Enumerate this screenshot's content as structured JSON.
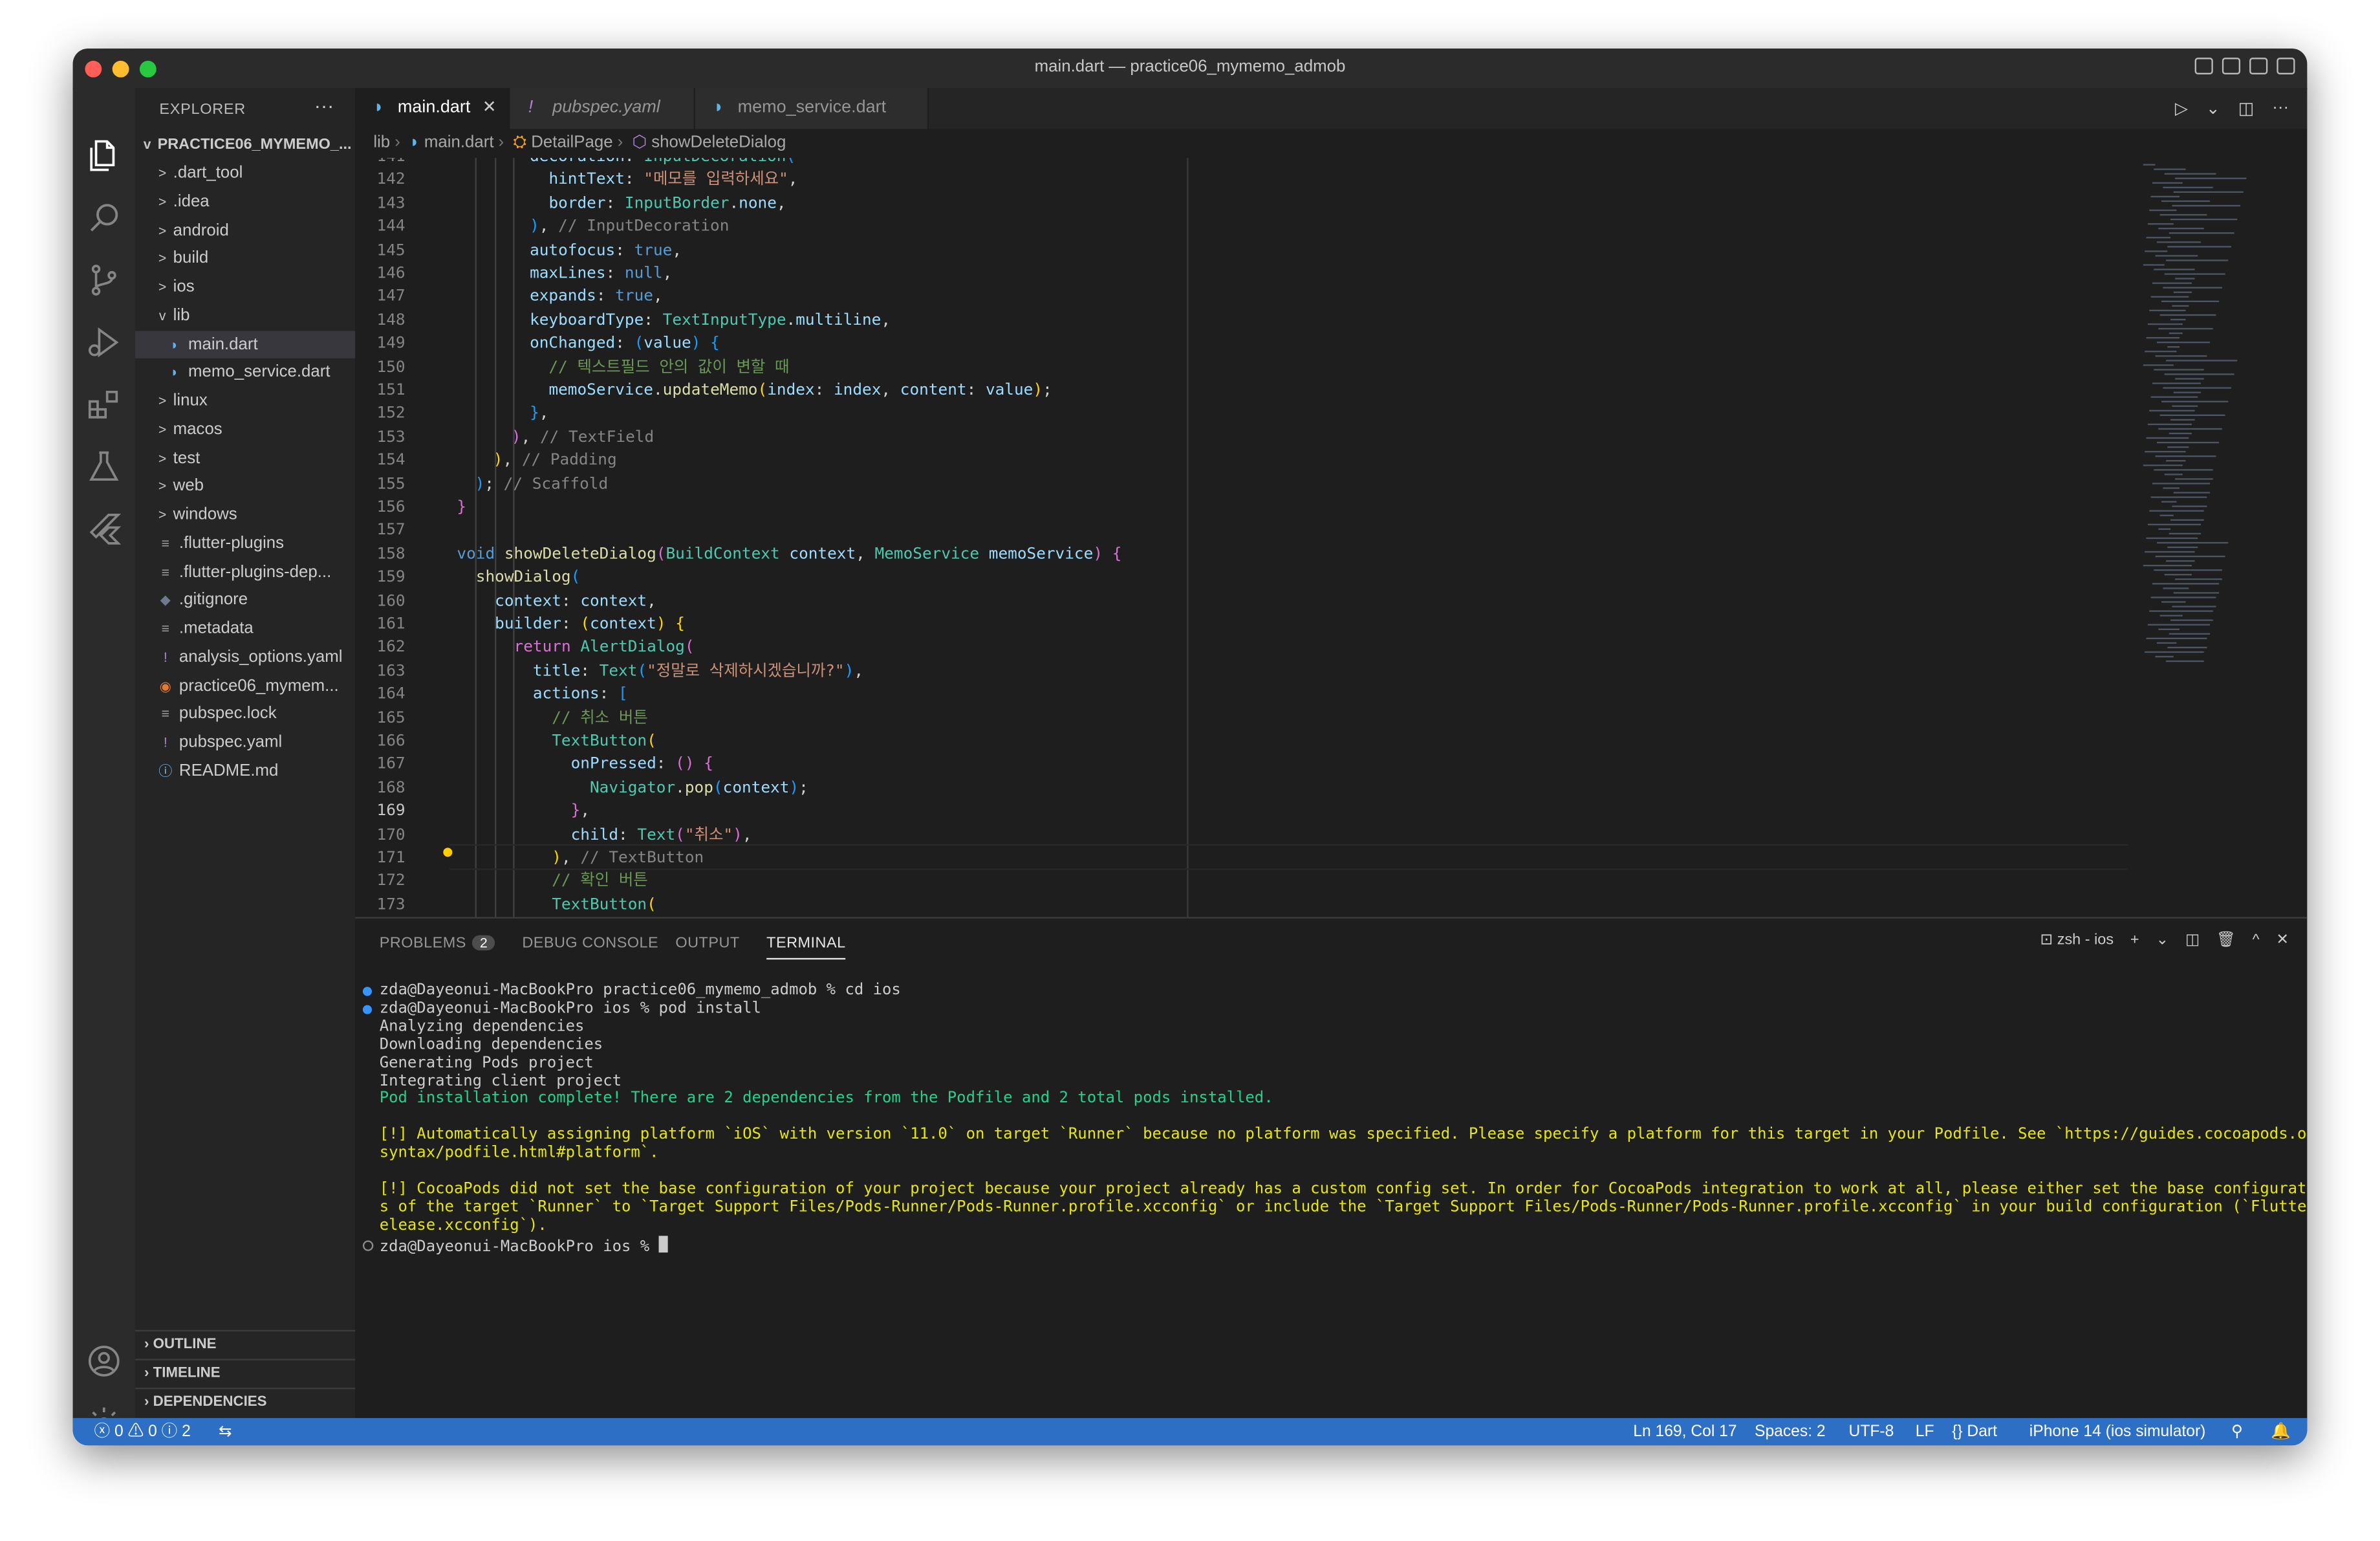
{
  "window": {
    "title": "main.dart — practice06_mymemo_admob",
    "lights": [
      "#ff5f57",
      "#febc2e",
      "#28c840"
    ]
  },
  "activity_bar": [
    "files-icon",
    "search-icon",
    "source-control-icon",
    "run-debug-icon",
    "extensions-icon",
    "testing-icon",
    "flutter-icon",
    "account-icon",
    "settings-gear-icon"
  ],
  "explorer": {
    "title": "EXPLORER",
    "more": "···",
    "root": "PRACTICE06_MYMEMO_...",
    "items": [
      {
        "label": ".dart_tool",
        "kind": "folder",
        "icon": ">"
      },
      {
        "label": ".idea",
        "kind": "folder",
        "icon": ">"
      },
      {
        "label": "android",
        "kind": "folder",
        "icon": ">"
      },
      {
        "label": "build",
        "kind": "folder",
        "icon": ">"
      },
      {
        "label": "ios",
        "kind": "folder",
        "icon": ">"
      },
      {
        "label": "lib",
        "kind": "folder-open",
        "icon": "v"
      },
      {
        "label": "main.dart",
        "kind": "dart",
        "icon": "◗"
      },
      {
        "label": "memo_service.dart",
        "kind": "dart",
        "icon": "◗"
      },
      {
        "label": "linux",
        "kind": "folder",
        "icon": ">"
      },
      {
        "label": "macos",
        "kind": "folder",
        "icon": ">"
      },
      {
        "label": "test",
        "kind": "folder",
        "icon": ">"
      },
      {
        "label": "web",
        "kind": "folder",
        "icon": ">"
      },
      {
        "label": "windows",
        "kind": "folder",
        "icon": ">"
      },
      {
        "label": ".flutter-plugins",
        "kind": "file",
        "icon": "≡"
      },
      {
        "label": ".flutter-plugins-dep...",
        "kind": "file",
        "icon": "≡"
      },
      {
        "label": ".gitignore",
        "kind": "git",
        "icon": "◆"
      },
      {
        "label": ".metadata",
        "kind": "file",
        "icon": "≡"
      },
      {
        "label": "analysis_options.yaml",
        "kind": "yaml",
        "icon": "!"
      },
      {
        "label": "practice06_mymem...",
        "kind": "rss",
        "icon": "◉"
      },
      {
        "label": "pubspec.lock",
        "kind": "file",
        "icon": "≡"
      },
      {
        "label": "pubspec.yaml",
        "kind": "yaml",
        "icon": "!"
      },
      {
        "label": "README.md",
        "kind": "info",
        "icon": "ⓘ"
      }
    ],
    "sections": [
      "OUTLINE",
      "TIMELINE",
      "DEPENDENCIES"
    ]
  },
  "tabs": [
    {
      "label": "main.dart",
      "icon": "◗",
      "active": true,
      "close": "✕"
    },
    {
      "label": "pubspec.yaml",
      "icon": "!",
      "active": false
    },
    {
      "label": "memo_service.dart",
      "icon": "◗",
      "active": false
    }
  ],
  "editor_actions": [
    "▷",
    "⌄",
    "◫",
    "···"
  ],
  "breadcrumb": [
    "lib",
    "main.dart",
    "DetailPage",
    "showDeleteDialog"
  ],
  "code_lines": [
    {
      "n": "141",
      "html": "<span class=\"prop\">decoration</span>: <span class=\"ty\">InputDecoration</span><span class=\"br3\">(</span>"
    },
    {
      "n": "142",
      "html": "  <span class=\"prop\">hintText</span>: <span class=\"str\">\"메모를 입력하세요\"</span>,"
    },
    {
      "n": "143",
      "html": "  <span class=\"prop\">border</span>: <span class=\"ty\">InputBorder</span>.<span class=\"prop\">none</span>,"
    },
    {
      "n": "144",
      "html": "<span class=\"br3\">)</span>, <span class=\"cmt2\">// InputDecoration</span>"
    },
    {
      "n": "145",
      "html": "<span class=\"prop\">autofocus</span>: <span class=\"kw\">true</span>,"
    },
    {
      "n": "146",
      "html": "<span class=\"prop\">maxLines</span>: <span class=\"kw\">null</span>,"
    },
    {
      "n": "147",
      "html": "<span class=\"prop\">expands</span>: <span class=\"kw\">true</span>,"
    },
    {
      "n": "148",
      "html": "<span class=\"prop\">keyboardType</span>: <span class=\"ty\">TextInputType</span>.<span class=\"prop\">multiline</span>,"
    },
    {
      "n": "149",
      "html": "<span class=\"prop\">onChanged</span>: <span class=\"br3\">(</span><span class=\"prop\">value</span><span class=\"br3\">)</span> <span class=\"br3\">{</span>"
    },
    {
      "n": "150",
      "html": "  <span class=\"cm\">// 텍스트필드 안의 값이 변할 때</span>"
    },
    {
      "n": "151",
      "html": "  <span class=\"prop\">memoService</span>.<span class=\"fn\">updateMemo</span><span class=\"br1\">(</span><span class=\"prop\">index</span>: <span class=\"prop\">index</span>, <span class=\"prop\">content</span>: <span class=\"prop\">value</span><span class=\"br1\">)</span>;"
    },
    {
      "n": "152",
      "html": "<span class=\"br3\">}</span>,"
    },
    {
      "n": "153",
      "html": "<span class=\"br2\">)</span>, <span class=\"cmt2\">// TextField</span>"
    },
    {
      "n": "154",
      "html": "<span class=\"br1\">)</span>, <span class=\"cmt2\">// Padding</span>"
    },
    {
      "n": "155",
      "html": "<span class=\"br3\">)</span>; <span class=\"cmt2\">// Scaffold</span>"
    },
    {
      "n": "156",
      "html": "<span class=\"br2\">}</span>"
    },
    {
      "n": "157",
      "html": ""
    },
    {
      "n": "158",
      "html": "<span class=\"kw\">void</span> <span class=\"fn\">showDeleteDialog</span><span class=\"br2\">(</span><span class=\"ty\">BuildContext</span> <span class=\"prop\">context</span>, <span class=\"ty\">MemoService</span> <span class=\"prop\">memoService</span><span class=\"br2\">)</span> <span class=\"br2\">{</span>"
    },
    {
      "n": "159",
      "html": "  <span class=\"fn\">showDialog</span><span class=\"br3\">(</span>"
    },
    {
      "n": "160",
      "html": "    <span class=\"prop\">context</span>: <span class=\"prop\">context</span>,"
    },
    {
      "n": "161",
      "html": "    <span class=\"prop\">builder</span>: <span class=\"br1\">(</span><span class=\"prop\">context</span><span class=\"br1\">)</span> <span class=\"br1\">{</span>"
    },
    {
      "n": "162",
      "html": "      <span class=\"br2\">return</span> <span class=\"ty\">AlertDialog</span><span class=\"br2\">(</span>"
    },
    {
      "n": "163",
      "html": "        <span class=\"prop\">title</span>: <span class=\"ty\">Text</span><span class=\"br3\">(</span><span class=\"str\">\"정말로 삭제하시겠습니까?\"</span><span class=\"br3\">)</span>,"
    },
    {
      "n": "164",
      "html": "        <span class=\"prop\">actions</span>: <span class=\"br3\">[</span>"
    },
    {
      "n": "165",
      "html": "          <span class=\"cm\">// 취소 버튼</span>"
    },
    {
      "n": "166",
      "html": "          <span class=\"ty\">TextButton</span><span class=\"br1\">(</span>"
    },
    {
      "n": "167",
      "html": "            <span class=\"prop\">onPressed</span>: <span class=\"br2\">()</span> <span class=\"br2\">{</span>"
    },
    {
      "n": "168",
      "html": "              <span class=\"ty\">Navigator</span>.<span class=\"fn\">pop</span><span class=\"br3\">(</span><span class=\"prop\">context</span><span class=\"br3\">)</span>;"
    },
    {
      "n": "169",
      "html": "            <span class=\"br2\">}</span>,"
    },
    {
      "n": "170",
      "html": "            <span class=\"prop\">child</span>: <span class=\"ty\">Text</span><span class=\"br2\">(</span><span class=\"str\">\"취소\"</span><span class=\"br2\">)</span>,"
    },
    {
      "n": "171",
      "html": "          <span class=\"br1\">)</span>, <span class=\"cmt2\">// TextButton</span>"
    },
    {
      "n": "172",
      "html": "          <span class=\"cm\">// 확인 버튼</span>"
    },
    {
      "n": "173",
      "html": "          <span class=\"ty\">TextButton</span><span class=\"br1\">(</span>"
    }
  ],
  "panel": {
    "tabs": [
      {
        "label": "PROBLEMS",
        "badge": "2"
      },
      {
        "label": "DEBUG CONSOLE"
      },
      {
        "label": "OUTPUT"
      },
      {
        "label": "TERMINAL",
        "active": true
      }
    ],
    "terminal_name": "zsh - ios",
    "terminal_icons": [
      "+",
      "⌄",
      "◫",
      "🗑",
      "^",
      "✕"
    ]
  },
  "terminal_lines": [
    {
      "text": "zda@Dayeonui-MacBookPro practice06_mymemo_admob % cd ios",
      "cls": "",
      "dot": "#3794ff"
    },
    {
      "text": "zda@Dayeonui-MacBookPro ios % pod install",
      "cls": "",
      "dot": "#3794ff"
    },
    {
      "text": "Analyzing dependencies",
      "cls": ""
    },
    {
      "text": "Downloading dependencies",
      "cls": ""
    },
    {
      "text": "Generating Pods project",
      "cls": ""
    },
    {
      "text": "Integrating client project",
      "cls": ""
    },
    {
      "text": "Pod installation complete! There are 2 dependencies from the Podfile and 2 total pods installed.",
      "cls": "green"
    },
    {
      "text": "",
      "cls": ""
    },
    {
      "text": "[!] Automatically assigning platform `iOS` with version `11.0` on target `Runner` because no platform was specified. Please specify a platform for this target in your Podfile. See `https://guides.cocoapods.org/",
      "cls": "yellow"
    },
    {
      "text": "syntax/podfile.html#platform`.",
      "cls": "yellow"
    },
    {
      "text": "",
      "cls": ""
    },
    {
      "text": "[!] CocoaPods did not set the base configuration of your project because your project already has a custom config set. In order for CocoaPods integration to work at all, please either set the base configuration",
      "cls": "yellow"
    },
    {
      "text": "s of the target `Runner` to `Target Support Files/Pods-Runner/Pods-Runner.profile.xcconfig` or include the `Target Support Files/Pods-Runner/Pods-Runner.profile.xcconfig` in your build configuration (`Flutter/R",
      "cls": "yellow"
    },
    {
      "text": "elease.xcconfig`).",
      "cls": "yellow"
    },
    {
      "text": "zda@Dayeonui-MacBookPro ios % ",
      "cls": "",
      "dot": "hollow",
      "cursor": true
    }
  ],
  "status": {
    "errors": "ⓧ 0",
    "warnings": "⚠ 0",
    "info": "ⓘ 2",
    "position": "Ln 169, Col 17",
    "spaces": "Spaces: 2",
    "encoding": "UTF-8",
    "eol": "LF",
    "language": "{} Dart",
    "device": "iPhone 14 (ios simulator)",
    "bg": "#2d6fc4"
  }
}
